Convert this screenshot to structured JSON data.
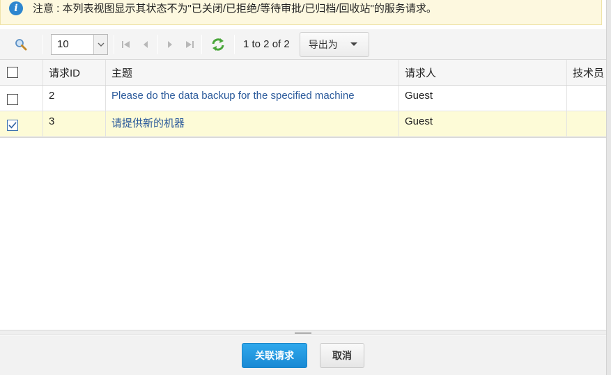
{
  "notice": {
    "icon": "info-icon",
    "text": "注意 : 本列表视图显示其状态不为\"已关闭/已拒绝/等待审批/已归档/回收站\"的服务请求。"
  },
  "toolbar": {
    "search_icon": "search-icon",
    "page_size": "10",
    "page_info": "1 to 2 of 2",
    "export_label": "导出为"
  },
  "table": {
    "columns": [
      "请求ID",
      "主题",
      "请求人",
      "技术员"
    ],
    "rows": [
      {
        "id": "2",
        "subject": "Please do the data backup for the specified machine",
        "requester": "Guest",
        "technician": "",
        "selected": false
      },
      {
        "id": "3",
        "subject": "请提供新的机器",
        "requester": "Guest",
        "technician": "",
        "selected": true
      }
    ]
  },
  "footer": {
    "associate_label": "关联请求",
    "cancel_label": "取消"
  },
  "colors": {
    "accent": "#1989d4",
    "link": "#2b5a9b",
    "notice_bg": "#fdf8df",
    "selected_row_bg": "#fdfbd7"
  }
}
